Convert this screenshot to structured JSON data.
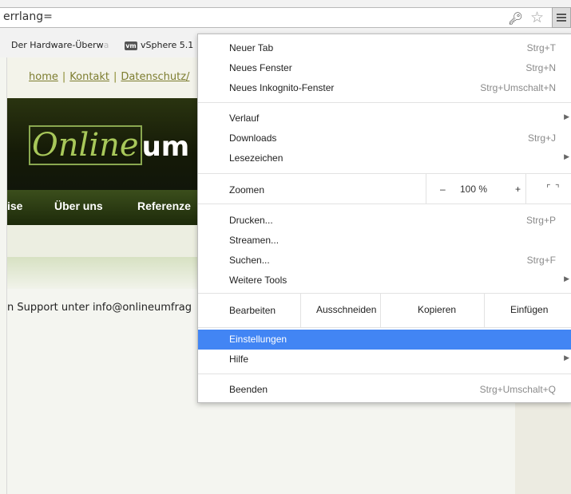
{
  "omnibox": {
    "url": "errlang="
  },
  "bookmarks": [
    {
      "label": "Der Hardware-Überw",
      "faded": "a"
    },
    {
      "icon_text": "vm",
      "label": "vSphere 5.1"
    }
  ],
  "page": {
    "links": [
      "home",
      "Kontakt",
      "Datenschutz/"
    ],
    "link_sep": "|",
    "logo_italic": "Online",
    "logo_bold": "um",
    "nav": [
      "ise",
      "Über uns",
      "Referenze"
    ],
    "support_text": "n Support unter info@onlineumfrag"
  },
  "menu": {
    "new_tab": {
      "label": "Neuer Tab",
      "shortcut": "Strg+T"
    },
    "new_window": {
      "label": "Neues Fenster",
      "shortcut": "Strg+N"
    },
    "incognito": {
      "label": "Neues Inkognito-Fenster",
      "shortcut": "Strg+Umschalt+N"
    },
    "history": {
      "label": "Verlauf"
    },
    "downloads": {
      "label": "Downloads",
      "shortcut": "Strg+J"
    },
    "bookmarks": {
      "label": "Lesezeichen"
    },
    "zoom": {
      "label": "Zoomen",
      "minus": "–",
      "value": "100 %",
      "plus": "+"
    },
    "print": {
      "label": "Drucken...",
      "shortcut": "Strg+P"
    },
    "cast": {
      "label": "Streamen..."
    },
    "find": {
      "label": "Suchen...",
      "shortcut": "Strg+F"
    },
    "more_tools": {
      "label": "Weitere Tools"
    },
    "edit": {
      "label": "Bearbeiten",
      "cut": "Ausschneiden",
      "copy": "Kopieren",
      "paste": "Einfügen"
    },
    "settings": {
      "label": "Einstellungen"
    },
    "help": {
      "label": "Hilfe"
    },
    "exit": {
      "label": "Beenden",
      "shortcut": "Strg+Umschalt+Q"
    }
  },
  "colors": {
    "highlight": "#4285f4",
    "banner_accent": "#a8c85a"
  },
  "icons": [
    "key-icon",
    "star-icon",
    "menu-icon",
    "vm-icon",
    "submenu-arrow-icon",
    "fullscreen-icon"
  ]
}
